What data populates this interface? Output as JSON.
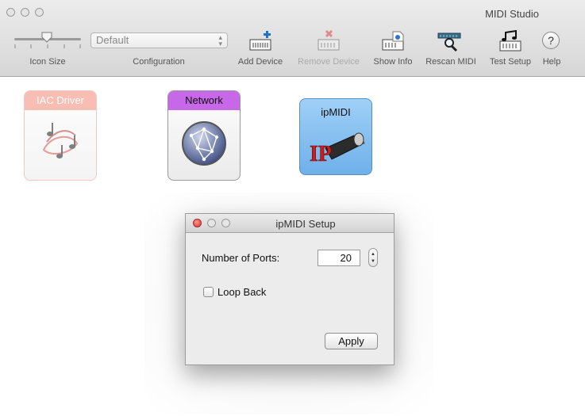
{
  "window": {
    "title": "MIDI Studio"
  },
  "toolbar": {
    "icon_size_label": "Icon Size",
    "configuration": {
      "value": "Default",
      "label": "Configuration"
    },
    "add_device_label": "Add Device",
    "remove_device_label": "Remove Device",
    "show_info_label": "Show Info",
    "rescan_midi_label": "Rescan MIDI",
    "test_setup_label": "Test Setup",
    "help_label": "Help",
    "help_glyph": "?"
  },
  "devices": [
    {
      "label": "IAC Driver",
      "icon": "music-notes-icon",
      "state": "offline",
      "color": "#f6a89a"
    },
    {
      "label": "Network",
      "icon": "globe-icon",
      "color": "#c768e8"
    },
    {
      "label": "ipMIDI",
      "icon": "ip-midi-cable-icon",
      "badge": "IP",
      "color": "#7fbdf0"
    }
  ],
  "dialog": {
    "title": "ipMIDI Setup",
    "ports_label": "Number of Ports:",
    "ports_value": "20",
    "loop_back_label": "Loop Back",
    "loop_back_checked": false,
    "apply_label": "Apply"
  }
}
